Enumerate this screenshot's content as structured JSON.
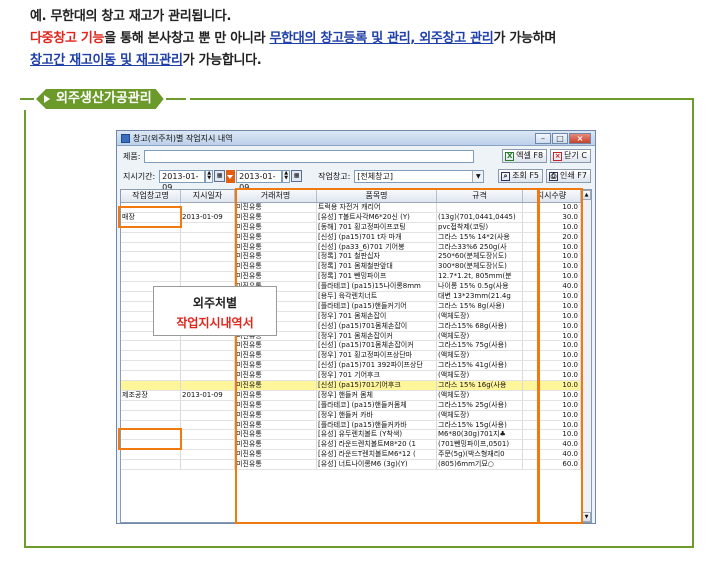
{
  "intro": {
    "line1": "예. 무한대의 창고 재고가 관리됩니다.",
    "line2_red": "다중창고 기능",
    "line2_mid": "을 통해 본사창고 뿐 만 아니라 ",
    "line2_link": "무한대의 창고등록 및 관리, 외주창고 관리",
    "line2_end": "가 가능하며",
    "line3_link": "창고간 재고이동 및 재고관리",
    "line3_end": "가 가능합니다."
  },
  "section_title": "외주생산가공관리",
  "window": {
    "title": "창고(외주처)별 작업지시 내역",
    "product_label": "제품:",
    "product_value": "",
    "excel_button": "엑셀 F8",
    "close_button": "닫기 C",
    "period_label": "지시기간:",
    "date_from": "2013-01-09",
    "date_to": "2013-01-09",
    "warehouse_label": "작업창고:",
    "warehouse_value": "[전체창고]",
    "search_button": "조회 F5",
    "print_button": "인쇄 F7",
    "columns": [
      "작업창고명",
      "지시일자",
      "거래처명",
      "품목명",
      "규격",
      "지시수량"
    ],
    "rows": [
      [
        "",
        "",
        "미진유통",
        "트럭용 자전거 캐리어",
        "",
        "10.0"
      ],
      [
        "매장",
        "2013-01-09",
        "미진유통",
        "[유성] T볼트사각M6*20신 (Y)",
        "(13g)(701,0441,0445)",
        "30.0"
      ],
      [
        "",
        "",
        "미진유통",
        "[동해] 701 횡고정파이프코팅",
        "pvc접착제(코팅)",
        "10.0"
      ],
      [
        "",
        "",
        "미진유통",
        "[신성] (pa15)701 t자 마개",
        "그라스 15% 14*2(사용",
        "20.0"
      ],
      [
        "",
        "",
        "미진유통",
        "[신성] (pa33_6)701 기어봉",
        "그라스33%6 250g(사",
        "10.0"
      ],
      [
        "",
        "",
        "미진유통",
        "[정록] 701 철판십자",
        "250*60(분체도장)(도)",
        "10.0"
      ],
      [
        "",
        "",
        "미진유통",
        "[정록] 701 몸체철판앞대",
        "300*80(분체도장)(도)",
        "10.0"
      ],
      [
        "",
        "",
        "미진유통",
        "[정록] 701 뺀밍파이프",
        "12.7*1.2t, 805mm(분",
        "10.0"
      ],
      [
        "",
        "",
        "미진유통",
        "[플라테코] (pa15)15나이롱8mm",
        "나이롱 15% 0.5g(사용",
        "40.0"
      ],
      [
        "",
        "",
        "미진유통",
        "[용두] 육각렌치너트",
        "대변 13*23mm(21.4g",
        "10.0"
      ],
      [
        "",
        "",
        "미진유통",
        "[플라테코] (pa15)핸들커기어",
        "그라스 15% 8g(사용)",
        "10.0"
      ],
      [
        "",
        "",
        "미진유통",
        "[정우] 701 몸체손잡이",
        "(액체도장)",
        "10.0"
      ],
      [
        "",
        "",
        "미진유통",
        "[신성] (pa15)701몸체손잡이",
        "그라스15% 68g(사용)",
        "10.0"
      ],
      [
        "",
        "",
        "미진유통",
        "[정우] 701 몸체손잡이커",
        "(액체도장)",
        "10.0"
      ],
      [
        "",
        "",
        "미진유통",
        "[신성] (pa15)701몸체손잡이커",
        "그라스15% 75g(사용)",
        "10.0"
      ],
      [
        "",
        "",
        "미진유통",
        "[정우] 701 횡고정파이프상단마",
        "(액체도장)",
        "10.0"
      ],
      [
        "",
        "",
        "미진유통",
        "[신성] (pa15)701 392파이프상단",
        "그라스15% 41g(사용)",
        "10.0"
      ],
      [
        "",
        "",
        "미진유통",
        "[정우] 701 기어후크",
        "(액체도장)",
        "10.0"
      ],
      [
        "",
        "",
        "미진유통",
        "[신성] (pa15)701기어후크",
        "그라스 15% 16g(사용",
        "10.0"
      ],
      [
        "제조공장",
        "2013-01-09",
        "미진유통",
        "[정우] 핸들커 몸체",
        "(액체도장)",
        "10.0"
      ],
      [
        "",
        "",
        "미진유통",
        "[플라테코] (pa15)핸들커몸체",
        "그라스15% 25g(사용)",
        "10.0"
      ],
      [
        "",
        "",
        "미진유통",
        "[정우] 핸들커 카바",
        "(액체도장)",
        "10.0"
      ],
      [
        "",
        "",
        "미진유통",
        "[플라테코] (pa15)핸들커카바",
        "그라스15% 15g(사용)",
        "10.0"
      ],
      [
        "",
        "",
        "미진유통",
        "[유성] 유두렌치볼트 (Y착색)",
        "M6*80(30g)701지♣",
        "10.0"
      ],
      [
        "",
        "",
        "미진유통",
        "[유성] 라운드렌치볼트M8*20 (1",
        "(701뺀밍파이프,0501)",
        "40.0"
      ],
      [
        "",
        "",
        "미진유통",
        "[유성] 라운드T렌치볼트M6*12 (",
        "주문(5g)(박스형재리0",
        "40.0"
      ],
      [
        "",
        "",
        "미진유통",
        "[유성] 너트나이롱M6 (3g)(Y)",
        "(805)6mm기묘○",
        "60.0"
      ]
    ]
  },
  "callout": {
    "line1": "외주처별",
    "line2": "작업지시내역서"
  }
}
